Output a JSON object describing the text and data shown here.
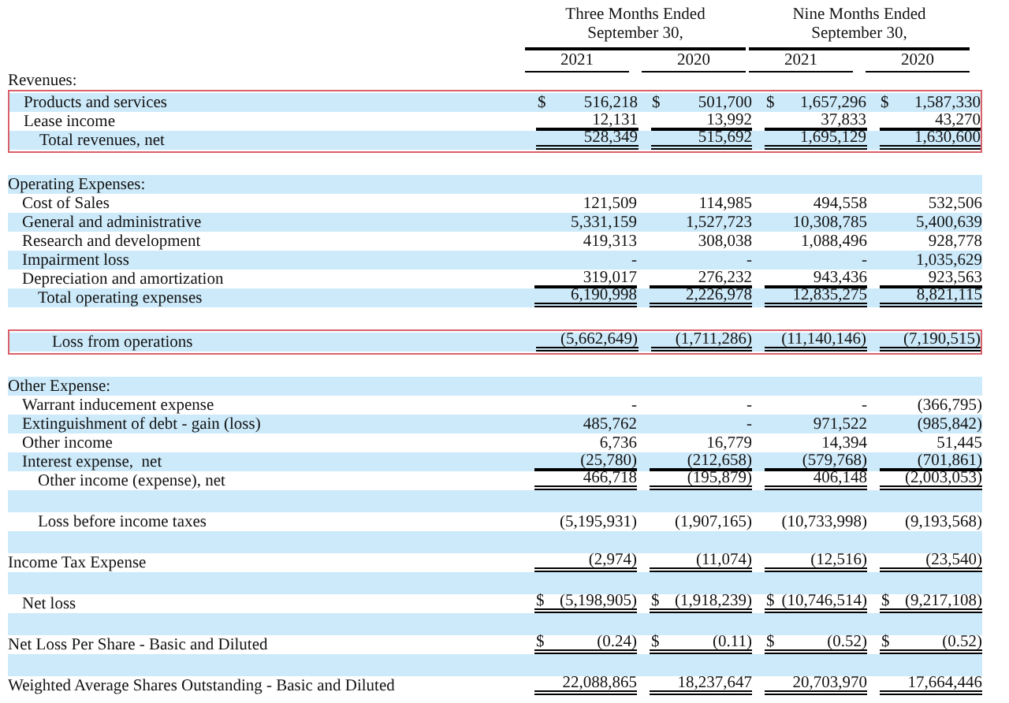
{
  "header": {
    "periods": [
      {
        "title": "Three Months Ended",
        "subtitle": "September 30,",
        "years": [
          "2021",
          "2020"
        ]
      },
      {
        "title": "Nine Months Ended",
        "subtitle": "September 30,",
        "years": [
          "2021",
          "2020"
        ]
      }
    ]
  },
  "groups": [
    {
      "boxed": false,
      "rows": [
        {
          "kind": "heading",
          "label": "Revenues:",
          "shaded": false,
          "cells": []
        }
      ]
    },
    {
      "boxed": true,
      "rows": [
        {
          "kind": "item",
          "label": "Products and services",
          "shaded": true,
          "rule_below": false,
          "cells": [
            {
              "prefix": "$",
              "value": "516,218"
            },
            {
              "prefix": "$",
              "value": "501,700"
            },
            {
              "prefix": "$",
              "value": "1,657,296"
            },
            {
              "prefix": "$",
              "value": "1,587,330"
            }
          ]
        },
        {
          "kind": "item",
          "label": "Lease income",
          "shaded": false,
          "rule_below": true,
          "double_rule": false,
          "cells": [
            {
              "value": "12,131"
            },
            {
              "value": "13,992"
            },
            {
              "value": "37,833"
            },
            {
              "value": "43,270"
            }
          ]
        },
        {
          "kind": "total",
          "label": "Total revenues, net",
          "shaded": true,
          "rule_below": true,
          "double_rule": true,
          "cells": [
            {
              "value": "528,349"
            },
            {
              "value": "515,692"
            },
            {
              "value": "1,695,129"
            },
            {
              "value": "1,630,600"
            }
          ]
        }
      ]
    },
    {
      "boxed": false,
      "rows": [
        {
          "kind": "blank",
          "shaded": false
        },
        {
          "kind": "heading",
          "label": "Operating Expenses:",
          "shaded": true,
          "cells": []
        },
        {
          "kind": "item",
          "label": "Cost of Sales",
          "shaded": false,
          "rule_below": false,
          "cells": [
            {
              "value": "121,509"
            },
            {
              "value": "114,985"
            },
            {
              "value": "494,558"
            },
            {
              "value": "532,506"
            }
          ]
        },
        {
          "kind": "item",
          "label": "General and administrative",
          "shaded": true,
          "rule_below": false,
          "cells": [
            {
              "value": "5,331,159"
            },
            {
              "value": "1,527,723"
            },
            {
              "value": "10,308,785"
            },
            {
              "value": "5,400,639"
            }
          ]
        },
        {
          "kind": "item",
          "label": "Research and development",
          "shaded": false,
          "rule_below": false,
          "cells": [
            {
              "value": "419,313"
            },
            {
              "value": "308,038"
            },
            {
              "value": "1,088,496"
            },
            {
              "value": "928,778"
            }
          ]
        },
        {
          "kind": "item",
          "label": "Impairment loss",
          "shaded": true,
          "rule_below": false,
          "cells": [
            {
              "value": "-"
            },
            {
              "value": "-"
            },
            {
              "value": "-"
            },
            {
              "value": "1,035,629"
            }
          ]
        },
        {
          "kind": "item",
          "label": "Depreciation and amortization",
          "shaded": false,
          "rule_below": true,
          "double_rule": false,
          "cells": [
            {
              "value": "319,017"
            },
            {
              "value": "276,232"
            },
            {
              "value": "943,436"
            },
            {
              "value": "923,563"
            }
          ]
        },
        {
          "kind": "total",
          "label": "Total operating expenses",
          "shaded": true,
          "rule_below": true,
          "double_rule": true,
          "cells": [
            {
              "value": "6,190,998"
            },
            {
              "value": "2,226,978"
            },
            {
              "value": "12,835,275"
            },
            {
              "value": "8,821,115"
            }
          ]
        },
        {
          "kind": "blank",
          "shaded": false
        }
      ]
    },
    {
      "boxed": true,
      "rows": [
        {
          "kind": "result",
          "label": "Loss from operations",
          "shaded": true,
          "rule_below": true,
          "double_rule": true,
          "cells": [
            {
              "value": "(5,662,649)"
            },
            {
              "value": "(1,711,286)"
            },
            {
              "value": "(11,140,146)"
            },
            {
              "value": "(7,190,515)"
            }
          ]
        }
      ]
    },
    {
      "boxed": false,
      "rows": [
        {
          "kind": "blank",
          "shaded": false
        },
        {
          "kind": "heading",
          "label": "Other Expense:",
          "shaded": true,
          "cells": []
        },
        {
          "kind": "item",
          "label": "Warrant inducement expense",
          "shaded": false,
          "rule_below": false,
          "cells": [
            {
              "value": "-"
            },
            {
              "value": "-"
            },
            {
              "value": "-"
            },
            {
              "value": "(366,795)"
            }
          ]
        },
        {
          "kind": "item",
          "label": "Extinguishment of debt - gain (loss)",
          "shaded": true,
          "rule_below": false,
          "cells": [
            {
              "value": "485,762"
            },
            {
              "value": "-"
            },
            {
              "value": "971,522"
            },
            {
              "value": "(985,842)"
            }
          ]
        },
        {
          "kind": "item",
          "label": "Other income",
          "shaded": false,
          "rule_below": false,
          "cells": [
            {
              "value": "6,736"
            },
            {
              "value": "16,779"
            },
            {
              "value": "14,394"
            },
            {
              "value": "51,445"
            }
          ]
        },
        {
          "kind": "item",
          "label": "Interest expense,  net",
          "shaded": true,
          "rule_below": true,
          "double_rule": false,
          "cells": [
            {
              "value": "(25,780)"
            },
            {
              "value": "(212,658)"
            },
            {
              "value": "(579,768)"
            },
            {
              "value": "(701,861)"
            }
          ]
        },
        {
          "kind": "total",
          "label": "Other income (expense), net",
          "shaded": false,
          "rule_below": true,
          "double_rule": true,
          "cells": [
            {
              "value": "466,718"
            },
            {
              "value": "(195,879)"
            },
            {
              "value": "406,148"
            },
            {
              "value": "(2,003,053)"
            }
          ]
        },
        {
          "kind": "blank",
          "shaded": true
        },
        {
          "kind": "total",
          "label": "Loss before income taxes",
          "shaded": false,
          "rule_below": false,
          "cells": [
            {
              "value": "(5,195,931)"
            },
            {
              "value": "(1,907,165)"
            },
            {
              "value": "(10,733,998)"
            },
            {
              "value": "(9,193,568)"
            }
          ]
        },
        {
          "kind": "blank",
          "shaded": true
        },
        {
          "kind": "heading",
          "label": "Income Tax Expense",
          "shaded": false,
          "rule_below": true,
          "double_rule": true,
          "cells": [
            {
              "value": "(2,974)"
            },
            {
              "value": "(11,074)"
            },
            {
              "value": "(12,516)"
            },
            {
              "value": "(23,540)"
            }
          ]
        },
        {
          "kind": "blank",
          "shaded": true
        },
        {
          "kind": "item",
          "label": "Net loss",
          "shaded": false,
          "rule_below": true,
          "double_rule": true,
          "cells": [
            {
              "prefix": "$",
              "value": "(5,198,905)"
            },
            {
              "prefix": "$",
              "value": "(1,918,239)"
            },
            {
              "prefix": "$",
              "value": "(10,746,514)"
            },
            {
              "prefix": "$",
              "value": "(9,217,108)"
            }
          ]
        },
        {
          "kind": "blank",
          "shaded": true
        },
        {
          "kind": "heading",
          "label": "Net Loss Per Share - Basic and Diluted",
          "shaded": false,
          "rule_below": true,
          "double_rule": true,
          "cells": [
            {
              "prefix": "$",
              "value": "(0.24)"
            },
            {
              "prefix": "$",
              "value": "(0.11)"
            },
            {
              "prefix": "$",
              "value": "(0.52)"
            },
            {
              "prefix": "$",
              "value": "(0.52)"
            }
          ]
        },
        {
          "kind": "blank",
          "shaded": true
        },
        {
          "kind": "heading",
          "label": "Weighted Average Shares Outstanding - Basic and Diluted",
          "shaded": false,
          "rule_below": true,
          "double_rule": true,
          "cells": [
            {
              "value": "22,088,865"
            },
            {
              "value": "18,237,647"
            },
            {
              "value": "20,703,970"
            },
            {
              "value": "17,664,446"
            }
          ]
        }
      ]
    }
  ]
}
